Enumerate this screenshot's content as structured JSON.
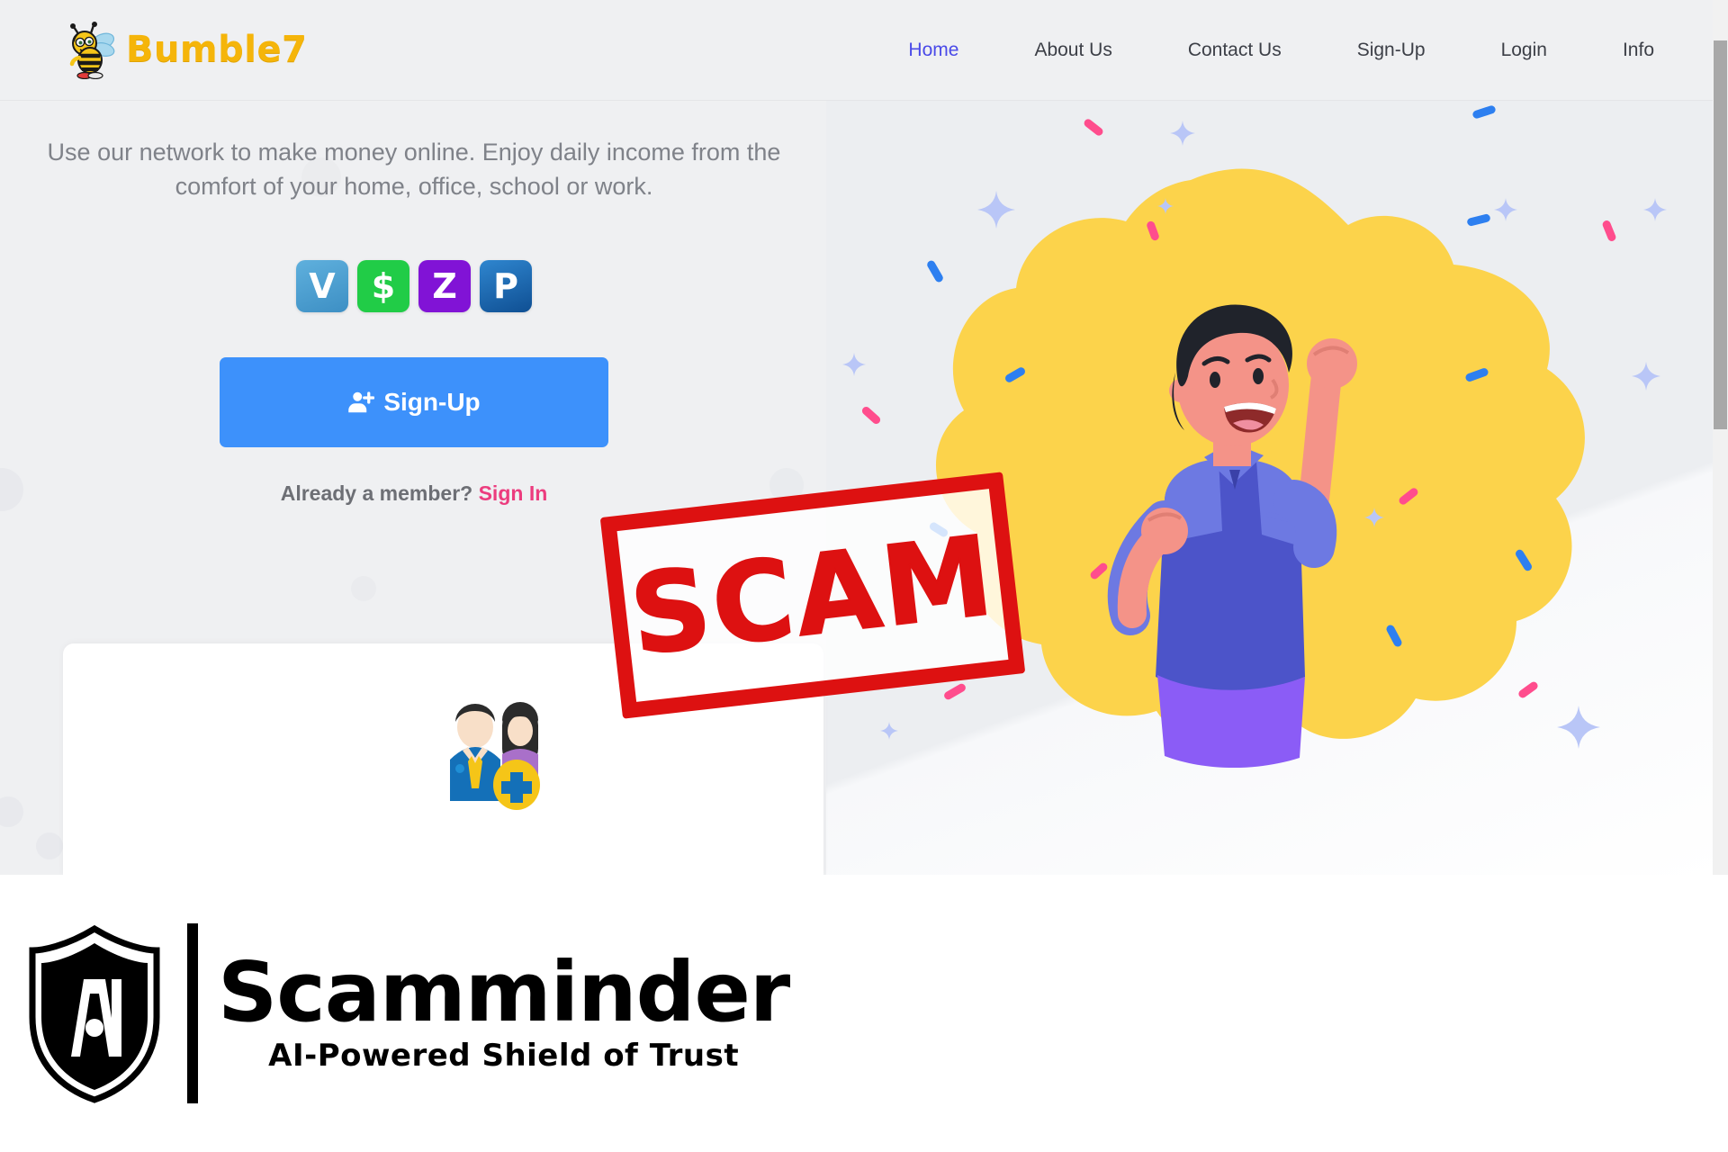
{
  "site": {
    "brand": {
      "name": "Bumble7",
      "logo_icon": "bee-icon",
      "color": "#f5b50a"
    },
    "nav": [
      {
        "label": "Home",
        "active": true
      },
      {
        "label": "About Us",
        "active": false
      },
      {
        "label": "Contact Us",
        "active": false
      },
      {
        "label": "Sign-Up",
        "active": false
      },
      {
        "label": "Login",
        "active": false
      },
      {
        "label": "Info",
        "active": false
      }
    ],
    "hero": {
      "subtitle": "Use our network to make money online. Enjoy daily income from the comfort of your home, office, school or work.",
      "payment_methods": [
        {
          "name": "venmo",
          "glyph": "V",
          "color": "#3d95ce"
        },
        {
          "name": "cash-app",
          "glyph": "$",
          "color": "#21cc47"
        },
        {
          "name": "zelle",
          "glyph": "Z",
          "color": "#8113d6"
        },
        {
          "name": "paypal",
          "glyph": "P",
          "color": "#1565b0"
        }
      ],
      "signup_button": "Sign-Up",
      "signup_icon": "user-plus-icon",
      "member_prompt": "Already a member?",
      "signin_link": "Sign In",
      "signin_color": "#ec3c7e"
    },
    "card": {
      "icon": "add-people-icon"
    },
    "illustration": {
      "name": "celebrating-man-illustration",
      "blob_color": "#fcd34b",
      "shirt_color": "#4c54c9",
      "pants_color": "#8b5cf6"
    },
    "scrollbar": {
      "name": "vertical-scrollbar",
      "thumb_color": "#a8a8a8"
    }
  },
  "overlay": {
    "stamp": {
      "text": "SCAM",
      "color": "#dd1111"
    }
  },
  "footer": {
    "logo_icon": "ai-shield-icon",
    "name": "Scamminder",
    "tagline": "AI-Powered Shield of Trust"
  }
}
